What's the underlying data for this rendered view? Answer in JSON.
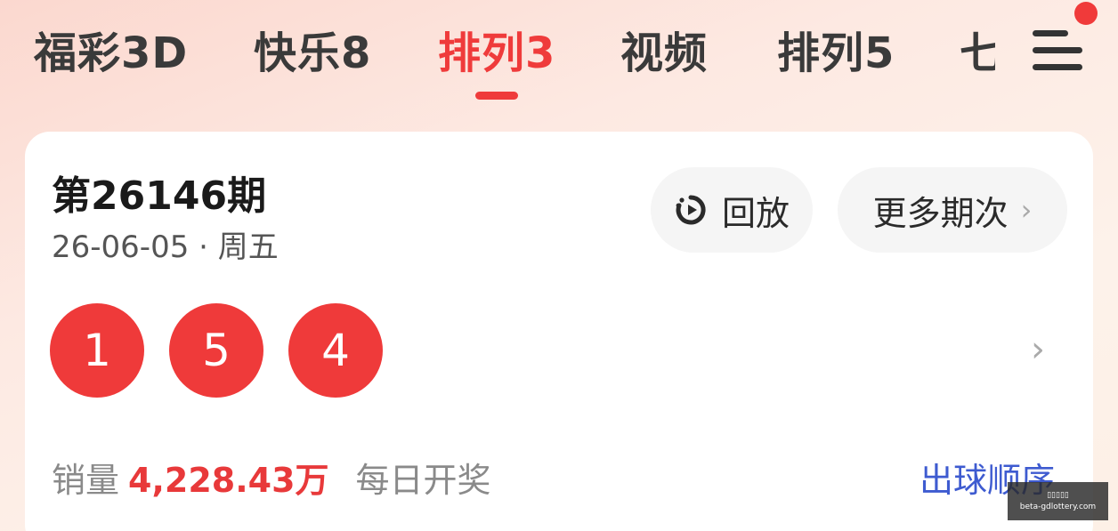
{
  "tabs": [
    {
      "label": "福彩3D",
      "active": false
    },
    {
      "label": "快乐8",
      "active": false
    },
    {
      "label": "排列3",
      "active": true
    },
    {
      "label": "视频",
      "active": false
    },
    {
      "label": "排列5",
      "active": false
    },
    {
      "label": "七",
      "active": false
    }
  ],
  "menu": {
    "icon": "menu-icon",
    "badge_color": "#f03a3a"
  },
  "draw": {
    "issue": "第26146期",
    "date": "26-06-05 · 周五",
    "numbers": [
      "1",
      "5",
      "4"
    ],
    "replay_label": "回放",
    "replay_icon": "replay-icon",
    "more_label": "更多期次",
    "more_icon": "chevron-right-icon",
    "sales_label": "销量",
    "sales_value": "4,228.43万",
    "frequency": "每日开奖",
    "order_link": "出球顺序"
  },
  "watermark": {
    "line1": "▯▯▯▯▯",
    "line2": "beta-gdlottery.com"
  },
  "colors": {
    "accent": "#ef3b3b",
    "link": "#3e5bd0",
    "ball": "#ef3a3a"
  }
}
